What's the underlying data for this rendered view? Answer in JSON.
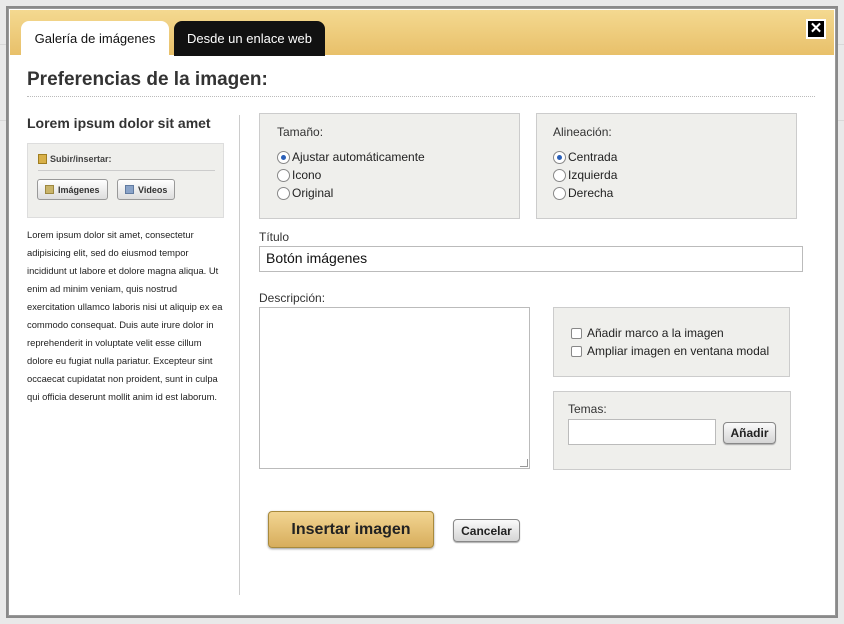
{
  "tabs": {
    "gallery": "Galería de imágenes",
    "web_link": "Desde un enlace web"
  },
  "close_label": "✕",
  "heading": "Preferencias de la imagen:",
  "sidebar": {
    "title": "Lorem ipsum dolor sit amet",
    "upload_label": "Subir/insertar:",
    "images_button": "Imágenes",
    "videos_button": "Videos",
    "body": "Lorem ipsum dolor sit amet, consectetur adipisicing elit, sed do eiusmod tempor incididunt ut labore et dolore magna aliqua. Ut enim ad minim veniam, quis nostrud exercitation ullamco laboris nisi ut aliquip ex ea commodo consequat. Duis aute irure dolor in reprehenderit in voluptate velit esse cillum dolore eu fugiat nulla pariatur. Excepteur sint occaecat cupidatat non proident, sunt in culpa qui officia deserunt mollit anim id est laborum."
  },
  "size": {
    "label": "Tamaño:",
    "options": [
      "Ajustar automáticamente",
      "Icono",
      "Original"
    ],
    "selected": "Ajustar automáticamente"
  },
  "alignment": {
    "label": "Alineación:",
    "options": [
      "Centrada",
      "Izquierda",
      "Derecha"
    ],
    "selected": "Centrada"
  },
  "title_field": {
    "label": "Título",
    "value": "Botón imágenes"
  },
  "description": {
    "label": "Descripción:",
    "value": ""
  },
  "options": {
    "frame": "Añadir marco a la imagen",
    "modal": "Ampliar imagen en ventana modal"
  },
  "themes": {
    "label": "Temas:",
    "value": "",
    "add_button": "Añadir"
  },
  "actions": {
    "insert": "Insertar imagen",
    "cancel": "Cancelar"
  },
  "colors": {
    "header_gold": "#e8c06a",
    "primary_button": "#d7ad5c",
    "radio_selected": "#2a5fb8"
  }
}
